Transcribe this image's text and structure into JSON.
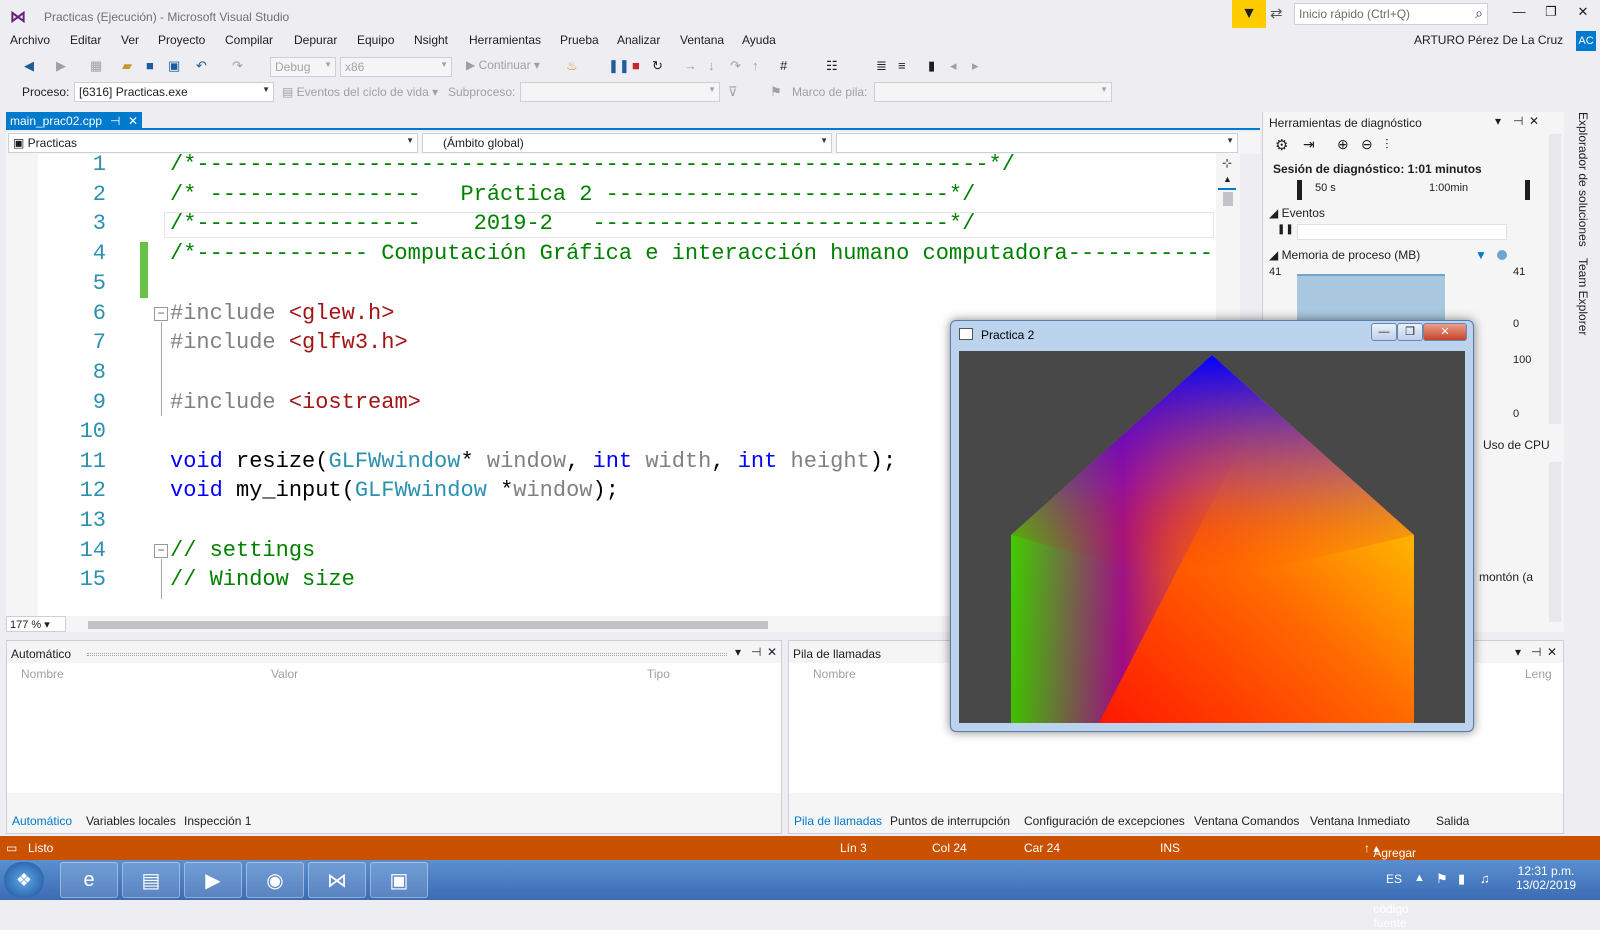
{
  "window": {
    "title": "Practicas (Ejecución) - Microsoft Visual Studio",
    "quick_launch_placeholder": "Inicio rápido (Ctrl+Q)",
    "user": "ARTURO Pérez De La Cruz",
    "avatar": "AC"
  },
  "menu": [
    "Archivo",
    "Editar",
    "Ver",
    "Proyecto",
    "Compilar",
    "Depurar",
    "Equipo",
    "Nsight",
    "Herramientas",
    "Prueba",
    "Analizar",
    "Ventana",
    "Ayuda"
  ],
  "toolbar": {
    "config": "Debug",
    "platform": "x86",
    "continue_label": "Continuar"
  },
  "toolbar2": {
    "process_label": "Proceso:",
    "process_value": "[6316] Practicas.exe",
    "lifecycle_label": "Eventos del ciclo de vida",
    "thread_label": "Subproceso:",
    "stack_label": "Marco de pila:"
  },
  "editor": {
    "tab": "main_prac02.cpp",
    "project_combo": "Practicas",
    "scope_combo": "(Ámbito global)",
    "zoom": "177 %"
  },
  "diagnostics": {
    "title": "Herramientas de diagnóstico",
    "session": "Sesión de diagnóstico: 1:01 minutos",
    "t1": "50 s",
    "t2": "1:00min",
    "events": "Eventos",
    "memory": "Memoria de proceso (MB)",
    "mem_top": "41",
    "mem_bottom": "0",
    "cpu_top": "100",
    "cpu_bottom": "0",
    "cpu_tab": "Uso de CPU",
    "heap": "montón (a"
  },
  "side_tabs": [
    "Explorador de soluciones",
    "Team Explorer"
  ],
  "auto_panel": {
    "title": "Automático",
    "columns": [
      "Nombre",
      "Valor",
      "Tipo"
    ],
    "tabs": [
      "Automático",
      "Variables locales",
      "Inspección 1"
    ]
  },
  "stack_panel": {
    "title": "Pila de llamadas",
    "columns": [
      "Nombre",
      "Leng"
    ],
    "tabs": [
      "Pila de llamadas",
      "Puntos de interrupción",
      "Configuración de excepciones",
      "Ventana Comandos",
      "Ventana Inmediato",
      "Salida"
    ]
  },
  "status": {
    "ready": "Listo",
    "line": "Lín 3",
    "col": "Col 24",
    "car": "Car 24",
    "ins": "INS",
    "source": "Agregar al control de código fuente"
  },
  "taskbar": {
    "lang": "ES",
    "time": "12:31 p.m.",
    "date": "13/02/2019"
  },
  "gl_window": {
    "title": "Practica 2"
  }
}
